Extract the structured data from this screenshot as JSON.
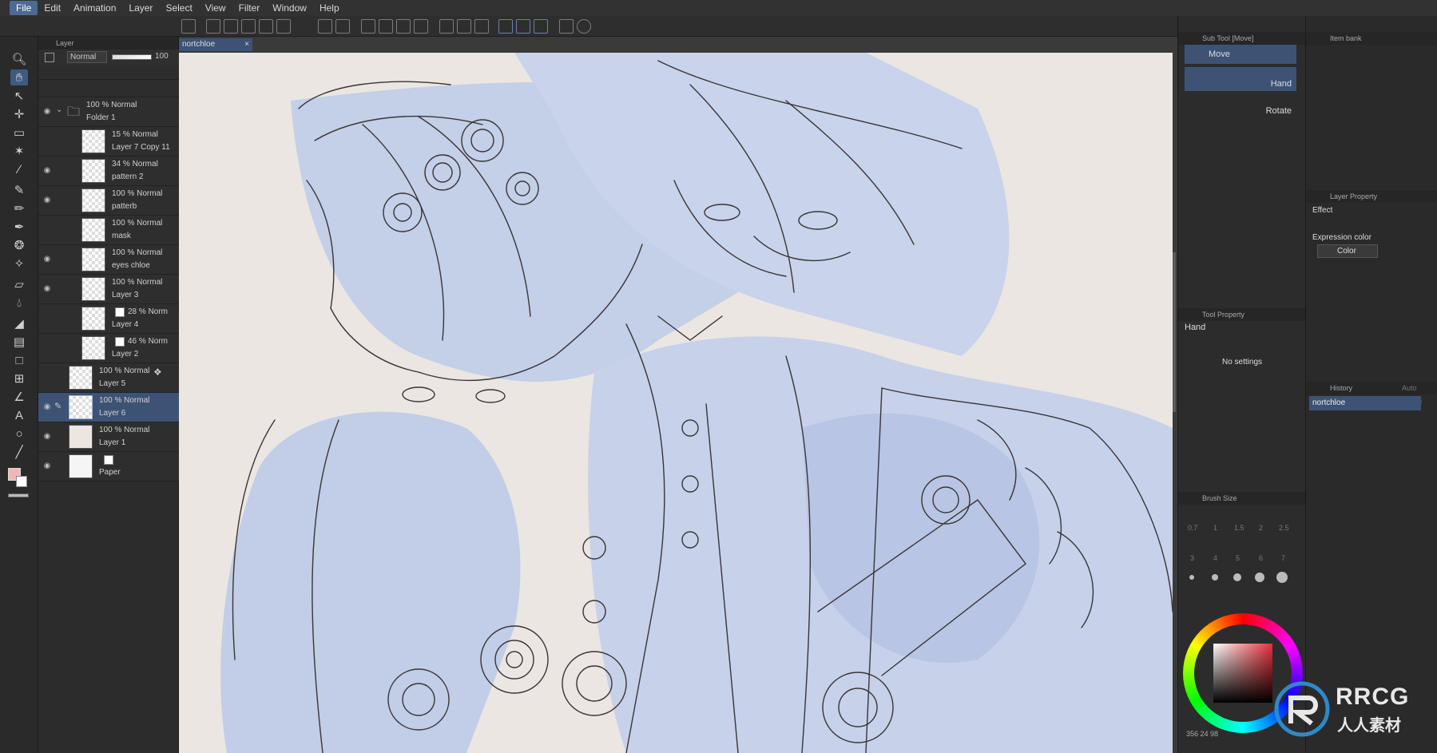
{
  "menu": [
    "File",
    "Edit",
    "Animation",
    "Layer",
    "Select",
    "View",
    "Filter",
    "Window",
    "Help"
  ],
  "layer_panel": {
    "tab_label": "Layer",
    "blend_mode": "Normal",
    "opacity": "100",
    "layers": [
      {
        "mode": "100 % Normal",
        "name": "Folder 1"
      },
      {
        "mode": "15 % Normal",
        "name": "Layer 7 Copy 11"
      },
      {
        "mode": "34 % Normal",
        "name": "pattern 2"
      },
      {
        "mode": "100 % Normal",
        "name": "patterb"
      },
      {
        "mode": "100 % Normal",
        "name": "mask"
      },
      {
        "mode": "100 % Normal",
        "name": "eyes chloe"
      },
      {
        "mode": "100 % Normal",
        "name": "Layer 3"
      },
      {
        "mode": "28 % Norm",
        "name": "Layer 4"
      },
      {
        "mode": "46 % Norm",
        "name": "Layer 2"
      },
      {
        "mode": "100 % Normal",
        "name": "Layer 5"
      },
      {
        "mode": "100 % Normal",
        "name": "Layer 6"
      },
      {
        "mode": "100 % Normal",
        "name": "Layer 1"
      },
      {
        "mode": "",
        "name": "Paper"
      }
    ]
  },
  "document": {
    "tab_name": "nortchloe",
    "close_glyph": "×"
  },
  "sub_tool": {
    "header": "Sub Tool [Move]",
    "items": [
      "Move",
      "Hand",
      "Rotate"
    ]
  },
  "tool_property": {
    "header": "Tool Property",
    "tool_name": "Hand",
    "message": "No settings"
  },
  "brush_size": {
    "header": "Brush Size",
    "sizes": [
      "0.7",
      "1",
      "1.5",
      "2",
      "2.5",
      "3",
      "4",
      "5",
      "6",
      "7"
    ]
  },
  "item_bank": {
    "header": "Item bank"
  },
  "layer_property": {
    "header": "Layer Property",
    "effect_label": "Effect",
    "expression_label": "Expression color",
    "expression_value": "Color"
  },
  "history": {
    "header": "History",
    "tab2": "Auto Action",
    "entries": [
      "nortchloe"
    ]
  },
  "status": {
    "coords": "356 24 98"
  },
  "watermark": {
    "brand": "RRCG",
    "sub": "人人素材"
  },
  "colors": {
    "accent": "#3d5375",
    "canvas_bg": "#ebe6e2",
    "sketch_blue": "#b9c6e4",
    "line": "#3a3535"
  }
}
